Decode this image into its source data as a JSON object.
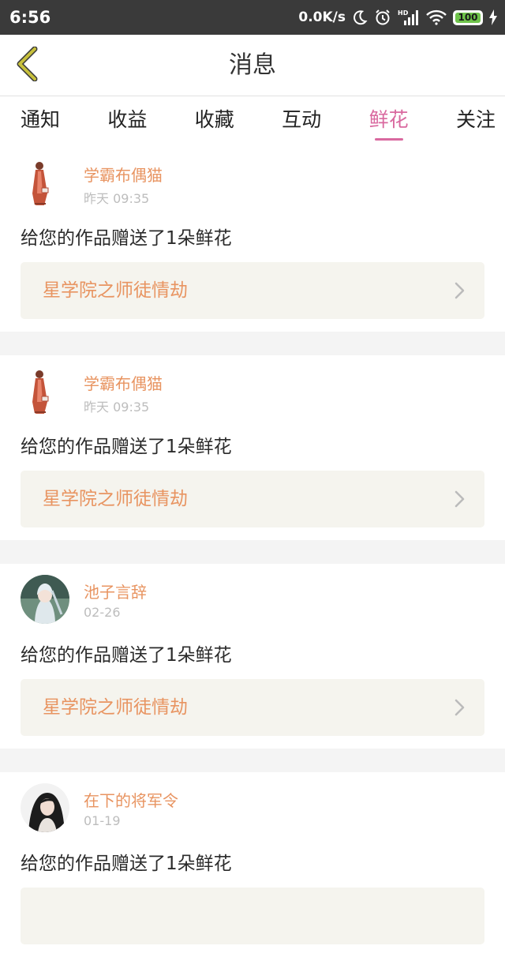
{
  "status_bar": {
    "time": "6:56",
    "speed": "0.0K/s",
    "battery": "100",
    "icons": [
      "moon-icon",
      "alarm-icon",
      "hd-signal-icon",
      "wifi-icon",
      "battery-icon",
      "charging-icon"
    ],
    "battery_color": "#6ec34a"
  },
  "header": {
    "title": "消息",
    "back_icon": "chevron-left-icon",
    "back_color": "#c7c03c"
  },
  "tabs": [
    {
      "label": "通知",
      "active": false
    },
    {
      "label": "收益",
      "active": false
    },
    {
      "label": "收藏",
      "active": false
    },
    {
      "label": "互动",
      "active": false
    },
    {
      "label": "鲜花",
      "active": true
    },
    {
      "label": "关注",
      "active": false
    }
  ],
  "accent_color": "#d9699f",
  "name_color": "#e89461",
  "messages": [
    {
      "user": "学霸布偶猫",
      "time": "昨天 09:35",
      "avatar": "doll-figure-avatar",
      "text": "给您的作品赠送了1朵鲜花",
      "work": "星学院之师徒情劫"
    },
    {
      "user": "学霸布偶猫",
      "time": "昨天 09:35",
      "avatar": "doll-figure-avatar",
      "text": "给您的作品赠送了1朵鲜花",
      "work": "星学院之师徒情劫"
    },
    {
      "user": "池子言辞",
      "time": "02-26",
      "avatar": "anime-girl-avatar",
      "text": "给您的作品赠送了1朵鲜花",
      "work": "星学院之师徒情劫"
    },
    {
      "user": "在下的将军令",
      "time": "01-19",
      "avatar": "anime-swordsman-avatar",
      "text": "给您的作品赠送了1朵鲜花",
      "work": ""
    }
  ]
}
